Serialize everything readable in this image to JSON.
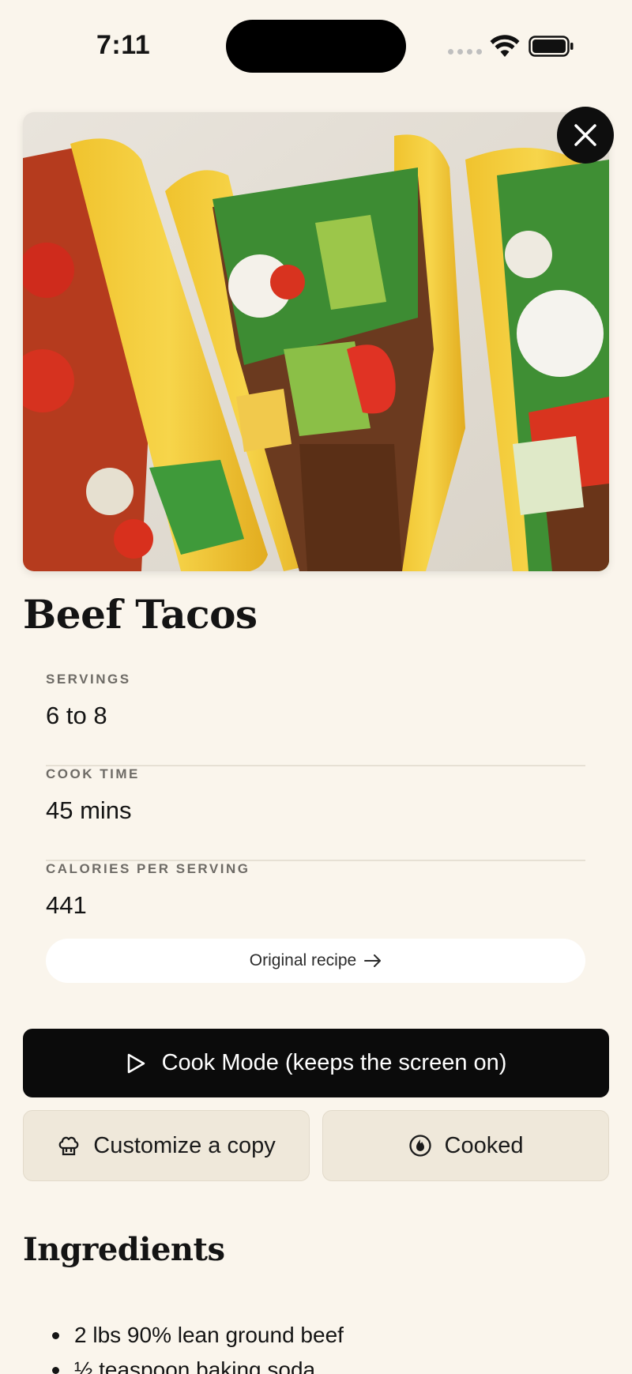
{
  "status_bar": {
    "time": "7:11"
  },
  "recipe": {
    "title": "Beef Tacos",
    "hero_image_icon": "beef-tacos-photo"
  },
  "info": [
    {
      "label": "SERVINGS",
      "value": "6 to 8"
    },
    {
      "label": "COOK TIME",
      "value": "45 mins"
    },
    {
      "label": "CALORIES PER SERVING",
      "value": "441"
    }
  ],
  "actions": {
    "original_recipe": "Original recipe",
    "cook_mode": "Cook Mode (keeps the screen on)",
    "customize": "Customize a copy",
    "cooked": "Cooked"
  },
  "ingredients": {
    "title": "Ingredients",
    "items": [
      "2 lbs 90% lean ground beef",
      "½ teaspoon baking soda"
    ]
  },
  "colors": {
    "background": "#FAF5EC",
    "primary_button": "#0B0B0B",
    "secondary_button": "#EFE8DA"
  }
}
